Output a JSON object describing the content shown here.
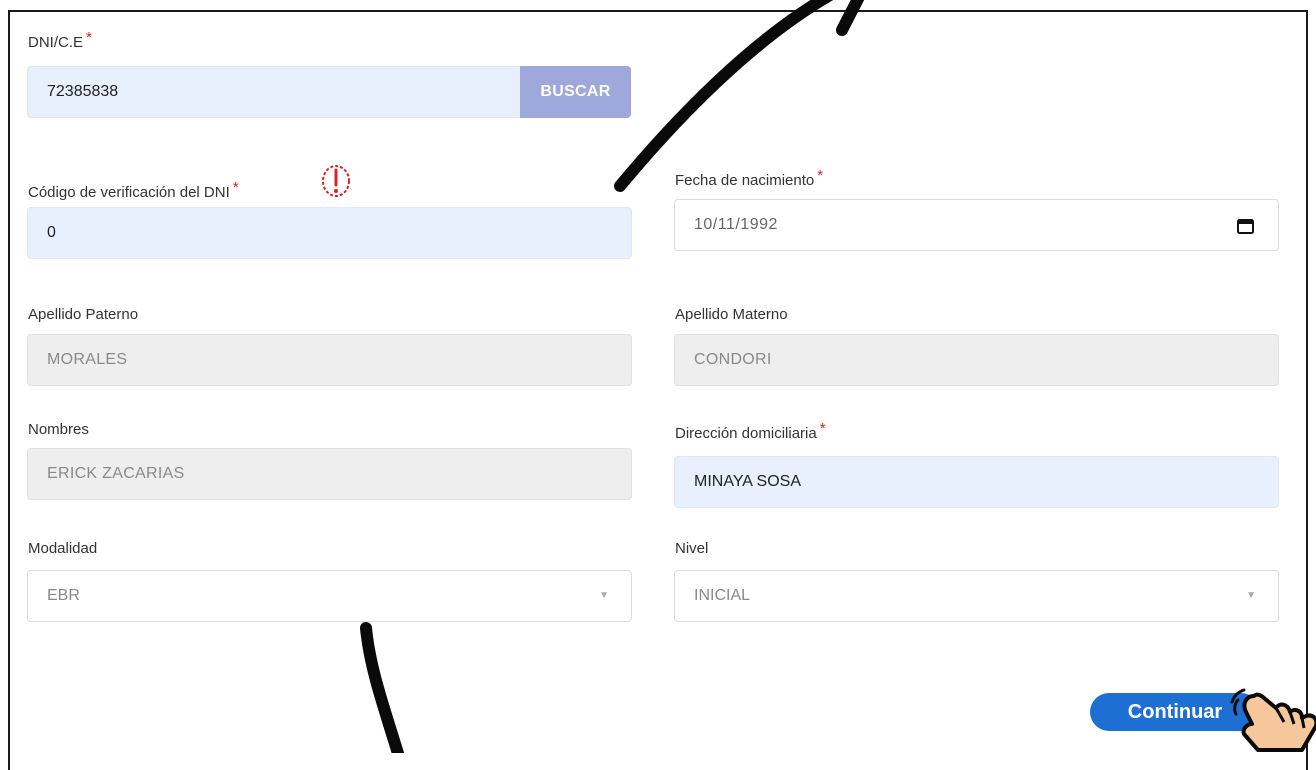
{
  "form": {
    "dni": {
      "label": "DNI/C.E",
      "required": "*",
      "value": "72385838",
      "search_label": "BUSCAR"
    },
    "verification": {
      "label": "Código de verificación del DNI",
      "required": "*",
      "value": "0",
      "alert_icon": "exclamation-circle-icon"
    },
    "birthdate": {
      "label": "Fecha de nacimiento",
      "required": "*",
      "value": "10/11/1992",
      "icon": "calendar-icon"
    },
    "paternal_surname": {
      "label": "Apellido Paterno",
      "value": "MORALES"
    },
    "maternal_surname": {
      "label": "Apellido Materno",
      "value": "CONDORI"
    },
    "names": {
      "label": "Nombres",
      "value": "ERICK ZACARIAS"
    },
    "address": {
      "label": "Dirección domiciliaria",
      "required": "*",
      "value": "MINAYA SOSA"
    },
    "modality": {
      "label": "Modalidad",
      "value": "EBR"
    },
    "level": {
      "label": "Nivel",
      "value": "INICIAL"
    },
    "continue_label": "Continuar"
  },
  "colors": {
    "accent": "#1e6fd4",
    "search_button": "#9fa8da",
    "required": "#e02020",
    "filled_input": "#e8f0fe",
    "disabled_input": "#eeeeee"
  },
  "annotations": {
    "pointer_icon": "hand-pointer-icon",
    "stroke_color": "#0a0a0a"
  }
}
